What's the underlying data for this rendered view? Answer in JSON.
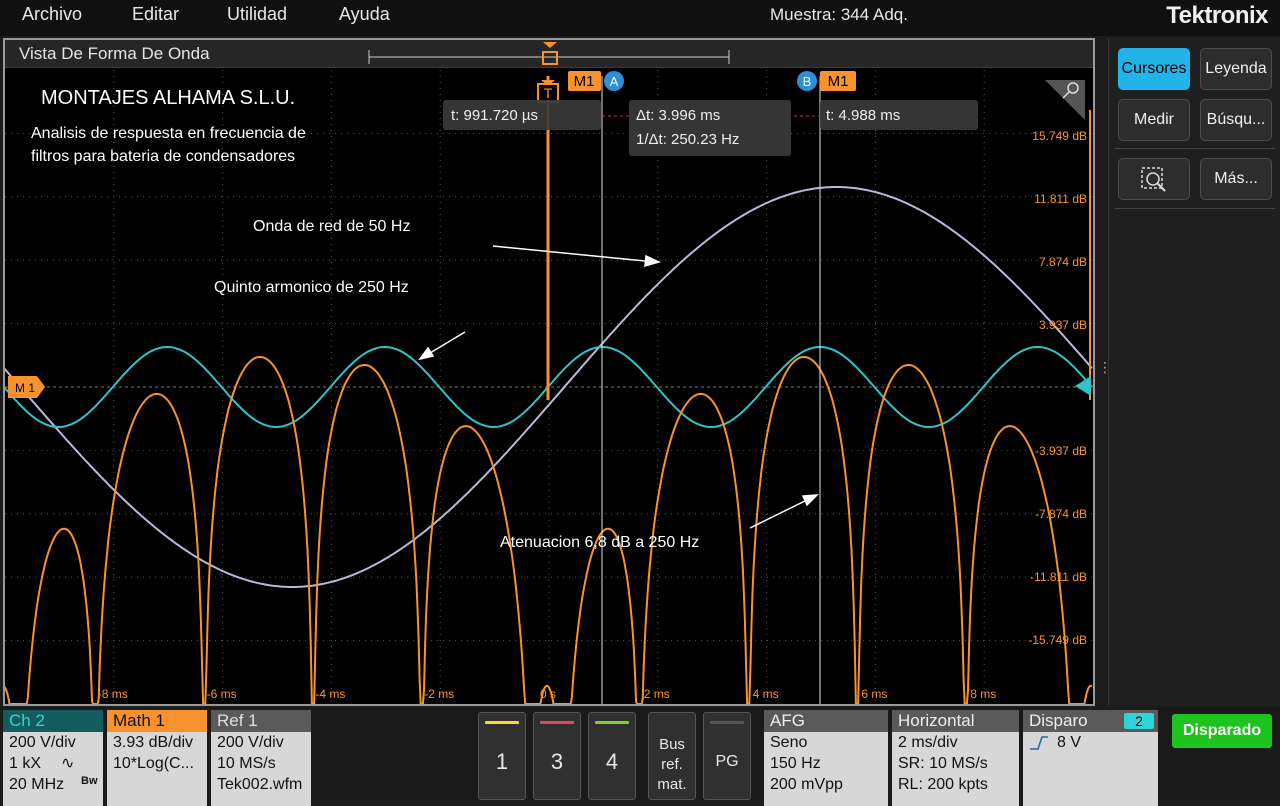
{
  "menu": {
    "archivo": "Archivo",
    "editar": "Editar",
    "utilidad": "Utilidad",
    "ayuda": "Ayuda"
  },
  "acquisition": "Muestra: 344 Adq.",
  "brand": "Tektronix",
  "waveform_view": {
    "title": "Vista De Forma De Onda",
    "company": "MONTAJES ALHAMA S.L.U.",
    "description_line1": "Analisis de respuesta en frecuencia de",
    "description_line2": "filtros para bateria de condensadores",
    "annotation_50hz": "Onda de red de 50 Hz",
    "annotation_250hz": "Quinto armonico de 250 Hz",
    "annotation_atten": "Atenuacion 6,8 dB a 250 Hz",
    "trigger_label": "T",
    "math_marker": "M 1",
    "cursor_a": {
      "badge": "A",
      "trace": "M1",
      "readout": "t: 991.720 µs"
    },
    "cursor_b": {
      "badge": "B",
      "trace": "M1",
      "readout": "t: 4.988 ms"
    },
    "delta_t": "Δt: 3.996 ms",
    "inv_delta_t": "1/Δt: 250.23 Hz",
    "y_ticks": [
      "15.749 dB",
      "11.811 dB",
      "7.874 dB",
      "3.937 dB",
      "-3.937 dB",
      "-7.874 dB",
      "-11.811 dB",
      "-15.749 dB"
    ],
    "x_ticks": [
      "-8 ms",
      "-6 ms",
      "-4 ms",
      "-2 ms",
      "0 s",
      "2 ms",
      "4 ms",
      "6 ms",
      "8 ms"
    ],
    "colors": {
      "math": "#f7922e",
      "channel2": "#2fc4c8",
      "ref1": "#b8b8d8",
      "cursor_badge": "#2e8fd8"
    }
  },
  "right_panel": {
    "cursores": "Cursores",
    "leyenda": "Leyenda",
    "medir": "Medir",
    "busqueda": "Búsqu...",
    "zoom_icon": "zoom-icon",
    "mas": "Más..."
  },
  "bottom": {
    "ch2": {
      "title": "Ch 2",
      "line1": "200 V/div",
      "line2": "1 kX",
      "line3": "20 MHz",
      "bw": "Bw"
    },
    "math1": {
      "title": "Math 1",
      "line1": "3.93 dB/div",
      "line2": "10*Log(C..."
    },
    "ref1": {
      "title": "Ref 1",
      "line1": "200 V/div",
      "line2": "10 MS/s",
      "line3": "Tek002.wfm"
    },
    "channel_buttons": [
      "1",
      "3",
      "4"
    ],
    "bus_ref": {
      "l1": "Bus",
      "l2": "ref.",
      "l3": "mat."
    },
    "pg": "PG",
    "afg": {
      "title": "AFG",
      "line1": "Seno",
      "line2": "150 Hz",
      "line3": "200 mVpp"
    },
    "horizontal": {
      "title": "Horizontal",
      "line1": "2 ms/div",
      "line2": "SR: 10 MS/s",
      "line3": "RL: 200 kpts"
    },
    "disparo": {
      "title": "Disparo",
      "channel": "2",
      "level": "8 V"
    },
    "status": "Disparado"
  }
}
